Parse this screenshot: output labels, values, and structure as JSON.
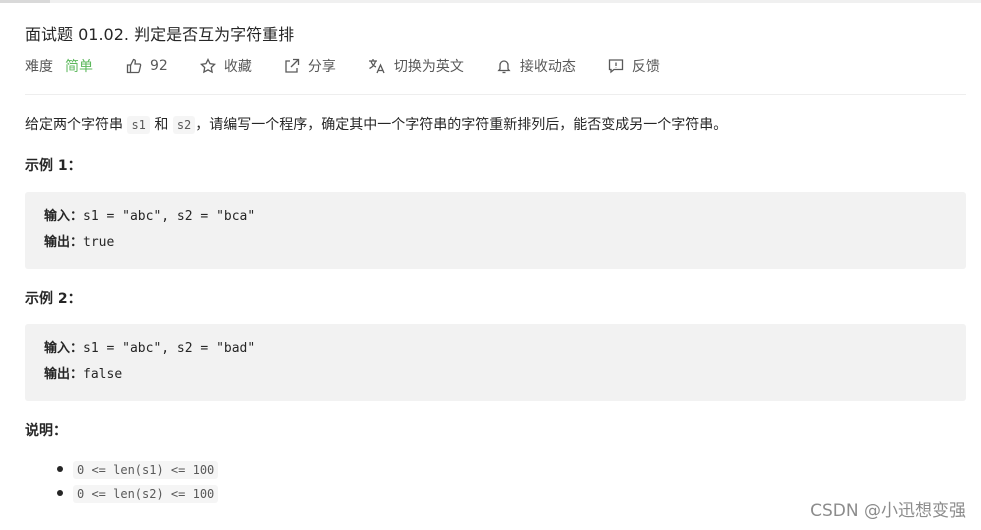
{
  "problem": {
    "title": "面试题 01.02. 判定是否互为字符重排",
    "difficulty_label": "难度",
    "difficulty": "简单",
    "likes": "92",
    "actions": {
      "favorite": "收藏",
      "share": "分享",
      "switch_lang": "切换为英文",
      "notify": "接收动态",
      "feedback": "反馈"
    }
  },
  "description": {
    "part1": "给定两个字符串 ",
    "var1": "s1",
    "part2": " 和 ",
    "var2": "s2",
    "part3": "，请编写一个程序，确定其中一个字符串的字符重新排列后，能否变成另一个字符串。"
  },
  "examples": [
    {
      "heading": "示例 1：",
      "input_label": "输入：",
      "input": "s1 = \"abc\", s2 = \"bca\"",
      "output_label": "输出：",
      "output": "true"
    },
    {
      "heading": "示例 2：",
      "input_label": "输入：",
      "input": "s1 = \"abc\", s2 = \"bad\"",
      "output_label": "输出：",
      "output": "false"
    }
  ],
  "notes": {
    "heading": "说明：",
    "items": [
      "0 <= len(s1) <= 100",
      "0 <= len(s2) <= 100"
    ]
  },
  "watermark": "CSDN @小迅想变强"
}
